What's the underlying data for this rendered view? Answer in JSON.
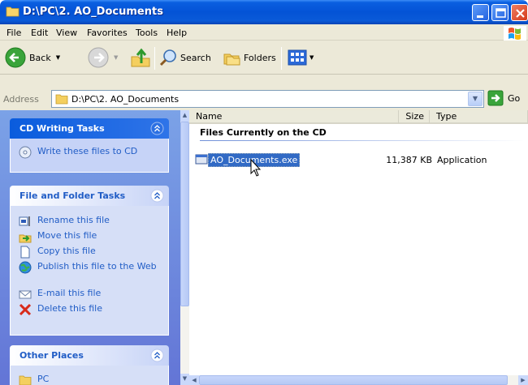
{
  "window": {
    "title": "D:\\PC\\2. AO_Documents"
  },
  "menu": [
    "File",
    "Edit",
    "View",
    "Favorites",
    "Tools",
    "Help"
  ],
  "toolbar": {
    "back": "Back",
    "search": "Search",
    "folders": "Folders"
  },
  "address": {
    "label": "Address",
    "value": "D:\\PC\\2. AO_Documents",
    "go": "Go"
  },
  "tasks": {
    "cd_writing": {
      "title": "CD Writing Tasks",
      "items": [
        "Write these files to CD"
      ]
    },
    "file_folder": {
      "title": "File and Folder Tasks",
      "items": [
        "Rename this file",
        "Move this file",
        "Copy this file",
        "Publish this file to the Web",
        "E-mail this file",
        "Delete this file"
      ]
    },
    "other_places": {
      "title": "Other Places",
      "items": [
        "PC"
      ]
    }
  },
  "list": {
    "columns": [
      "Name",
      "Size",
      "Type"
    ],
    "group_label": "Files Currently on the CD",
    "files": [
      {
        "name": "AO_Documents.exe",
        "size": "11,387 KB",
        "type": "Application"
      }
    ]
  },
  "colors": {
    "title_bar": "#0453d6",
    "task_pane": "#7ba2e7",
    "link": "#215dc6",
    "selection": "#316ac5"
  }
}
